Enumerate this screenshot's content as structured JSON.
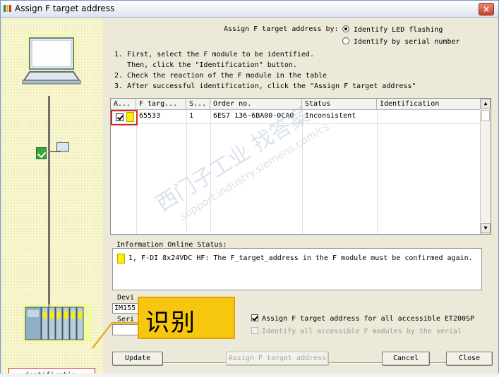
{
  "window": {
    "title": "Assign F target address",
    "close_label": "×"
  },
  "header": {
    "assign_by_label": "Assign F target address by:",
    "options": [
      {
        "label": "Identify LED flashing",
        "selected": true
      },
      {
        "label": "Identify by serial number",
        "selected": false
      }
    ]
  },
  "instructions": {
    "line1": "1. First, select the F module to be identified.",
    "line2": "   Then, click the \"Identification\" button.",
    "line3": "2. Check the reaction of the F module in the table",
    "line4": "3. After successful identification, click the \"Assign F target address\""
  },
  "table": {
    "columns": [
      "A...",
      "F targ...",
      "S...",
      "Order no.",
      "Status",
      "Identification"
    ],
    "rows": [
      {
        "checked": true,
        "indicator_color": "#ffee00",
        "f_target": "65533",
        "slot": "1",
        "order_no": "6ES7 136-6BA00-0CA0",
        "status": "Inconsistent",
        "identification": ""
      }
    ]
  },
  "info": {
    "label": "Information Online Status:",
    "message": "1, F-DI 8x24VDC HF: The F_target_address in the F module must be confirmed again."
  },
  "device": {
    "label": "Devi",
    "value": "IM155",
    "serial_label": "Seri"
  },
  "checks": [
    {
      "label": "Assign F target address for all accessible ET200SP",
      "checked": true,
      "enabled": true
    },
    {
      "label": "Identify all accessible F modules by the serial",
      "checked": false,
      "enabled": false
    }
  ],
  "buttons": {
    "identification": "dentificatio",
    "update": "Update",
    "assign": "Assign F target address",
    "cancel": "Cancel",
    "close": "Close"
  },
  "callout": {
    "text": "识别"
  },
  "watermark": {
    "text": "西门子工业 找答案",
    "url": "support.industry.siemens.com/cs"
  },
  "colors": {
    "callout_fill": "#f7c710",
    "highlight_red": "#d42424",
    "status_yellow": "#ffee00",
    "ok_green": "#3aa53a"
  }
}
